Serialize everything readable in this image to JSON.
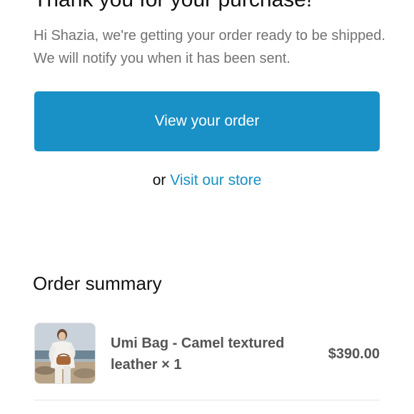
{
  "header": {
    "title": "Thank you for your purchase!",
    "message": "Hi Shazia, we're getting your order ready to be shipped. We will notify you when it has been sent."
  },
  "actions": {
    "view_order_label": "View your order",
    "or_text": "or",
    "visit_store_label": "Visit our store"
  },
  "colors": {
    "accent": "#1990c6",
    "muted_text": "#727272",
    "item_text": "#555555"
  },
  "order_summary": {
    "title": "Order summary",
    "items": [
      {
        "name": "Umi Bag - Camel textured leather × 1",
        "price": "$390.00",
        "image_icon": "product-photo"
      }
    ]
  }
}
